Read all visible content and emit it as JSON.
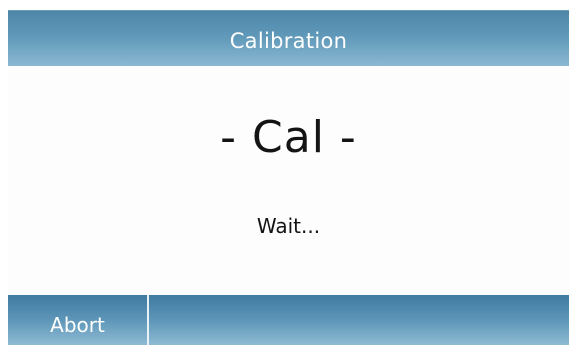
{
  "header": {
    "title": "Calibration"
  },
  "main": {
    "status_title": "- Cal -",
    "status_message": "Wait..."
  },
  "footer": {
    "abort_label": "Abort"
  }
}
